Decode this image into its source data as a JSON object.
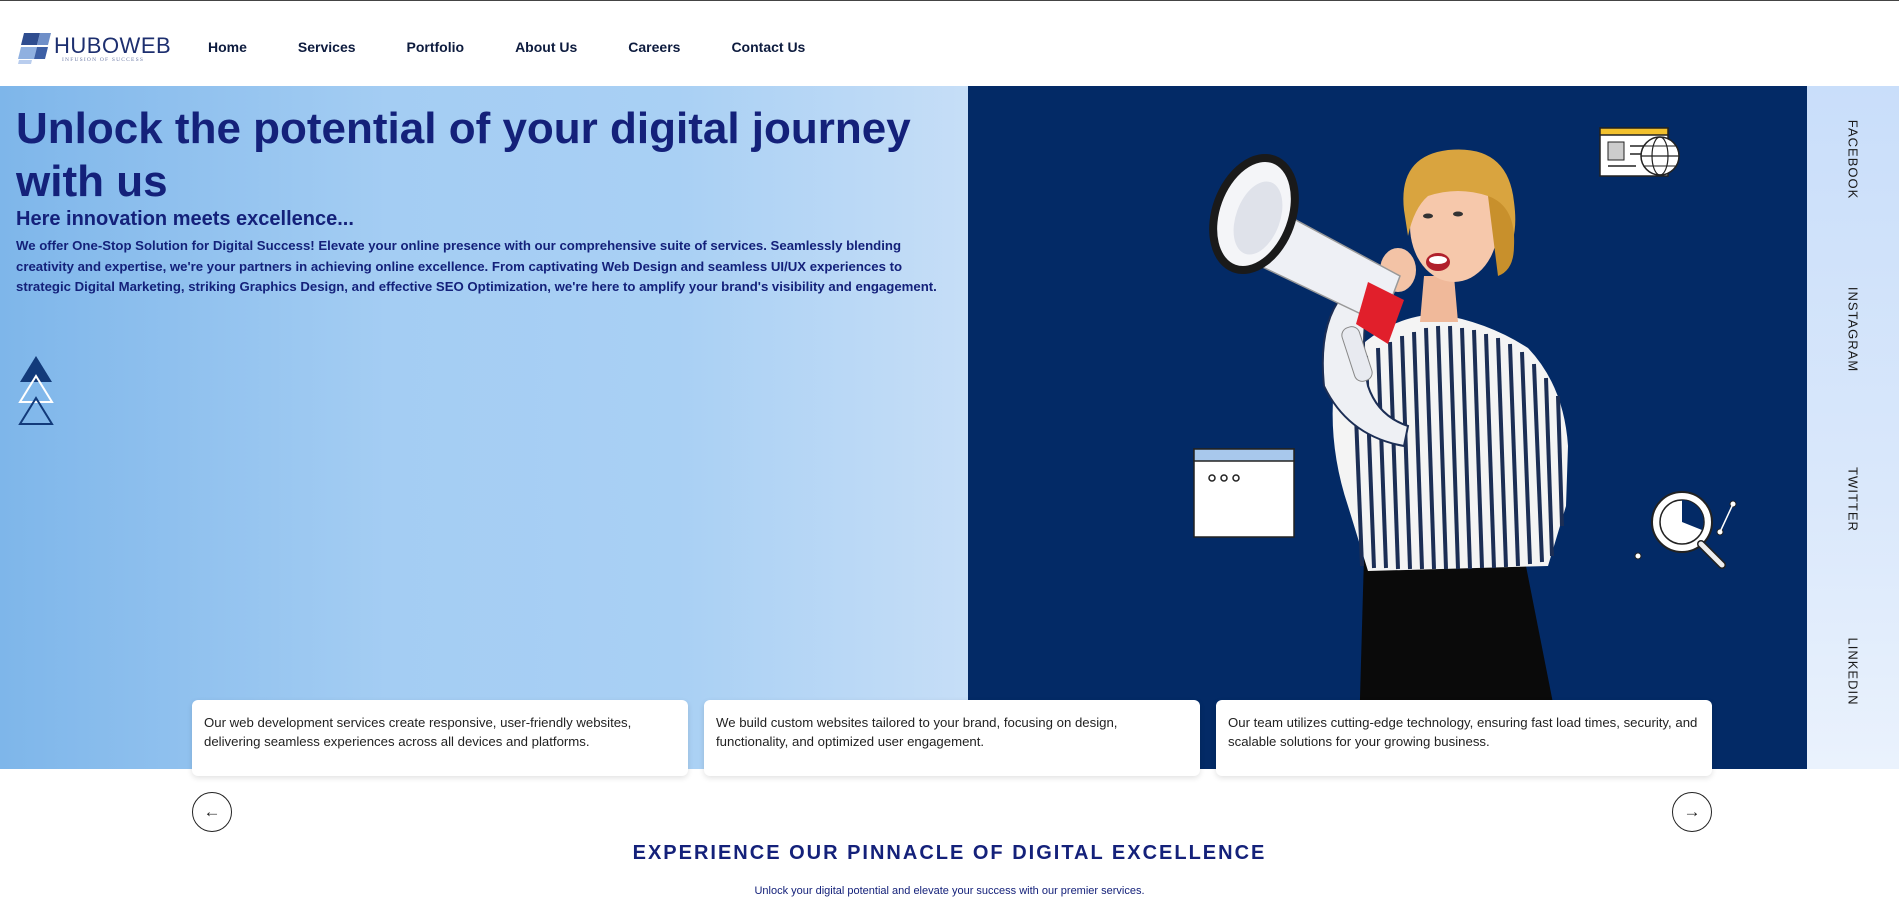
{
  "brand": {
    "name": "HUBOWEB",
    "tagline": "INFUSION OF SUCCESS"
  },
  "nav": {
    "items": [
      "Home",
      "Services",
      "Portfolio",
      "About Us",
      "Careers",
      "Contact Us"
    ]
  },
  "hero": {
    "title": "Unlock the potential of your digital journey with us",
    "subtitle": "Here innovation meets excellence...",
    "description": "We offer One-Stop Solution for Digital Success! Elevate your online presence with our comprehensive suite of services. Seamlessly blending creativity and expertise, we're your partners in achieving online excellence. From captivating Web Design and seamless UI/UX experiences to strategic Digital Marketing, striking Graphics Design, and effective SEO Optimization, we're here to amplify your brand's visibility and engagement."
  },
  "social": {
    "items": [
      "FACEBOOK",
      "INSTAGRAM",
      "TWITTER",
      "LINKEDIN"
    ]
  },
  "cards": [
    "Our web development services create responsive, user-friendly websites, delivering seamless experiences across all devices and platforms.",
    "We build custom websites tailored to your brand, focusing on design, functionality, and optimized user engagement.",
    "Our team utilizes cutting-edge technology, ensuring fast load times, security, and scalable solutions for your growing business."
  ],
  "carousel": {
    "prev_label": "←",
    "next_label": "→"
  },
  "section": {
    "title": "EXPERIENCE OUR PINNACLE OF DIGITAL EXCELLENCE",
    "subtitle": "Unlock your digital potential and elevate your success with our premier services."
  },
  "colors": {
    "navy": "#032a66",
    "heading": "#14217a",
    "hero_light": "#a9d0f4"
  },
  "icons": [
    "logo-mark-icon",
    "triangles-icon",
    "megaphone-icon",
    "browser-globe-icon",
    "browser-window-icon",
    "analytics-magnifier-icon"
  ]
}
